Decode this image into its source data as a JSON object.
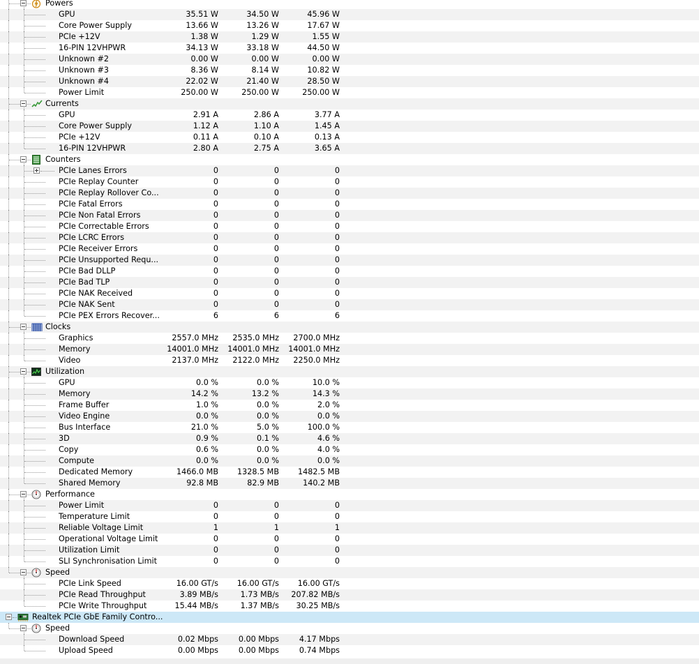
{
  "window": {
    "title": "",
    "selection_color": "#cde8f7"
  },
  "tree": [
    {
      "kind": "group",
      "label": "Powers",
      "icon": "power-icon",
      "level": 1,
      "first": true
    },
    {
      "kind": "sensor",
      "label": "GPU",
      "values": [
        "35.51 W",
        "34.50 W",
        "45.96 W"
      ]
    },
    {
      "kind": "sensor",
      "label": "Core Power Supply",
      "values": [
        "13.66 W",
        "13.26 W",
        "17.67 W"
      ]
    },
    {
      "kind": "sensor",
      "label": "PCIe +12V",
      "values": [
        "1.38 W",
        "1.29 W",
        "1.55 W"
      ]
    },
    {
      "kind": "sensor",
      "label": "16-PIN 12VHPWR",
      "values": [
        "34.13 W",
        "33.18 W",
        "44.50 W"
      ]
    },
    {
      "kind": "sensor",
      "label": "Unknown #2",
      "values": [
        "0.00 W",
        "0.00 W",
        "0.00 W"
      ]
    },
    {
      "kind": "sensor",
      "label": "Unknown #3",
      "values": [
        "8.36 W",
        "8.14 W",
        "10.82 W"
      ]
    },
    {
      "kind": "sensor",
      "label": "Unknown #4",
      "values": [
        "22.02 W",
        "21.40 W",
        "28.50 W"
      ]
    },
    {
      "kind": "sensor",
      "label": "Power Limit",
      "values": [
        "250.00 W",
        "250.00 W",
        "250.00 W"
      ]
    },
    {
      "kind": "group",
      "label": "Currents",
      "icon": "current-icon",
      "level": 1
    },
    {
      "kind": "sensor",
      "label": "GPU",
      "values": [
        "2.91 A",
        "2.86 A",
        "3.77 A"
      ]
    },
    {
      "kind": "sensor",
      "label": "Core Power Supply",
      "values": [
        "1.12 A",
        "1.10 A",
        "1.45 A"
      ]
    },
    {
      "kind": "sensor",
      "label": "PCIe +12V",
      "values": [
        "0.11 A",
        "0.10 A",
        "0.13 A"
      ]
    },
    {
      "kind": "sensor",
      "label": "16-PIN 12VHPWR",
      "values": [
        "2.80 A",
        "2.75 A",
        "3.65 A"
      ]
    },
    {
      "kind": "group",
      "label": "Counters",
      "icon": "counter-icon",
      "level": 1
    },
    {
      "kind": "sensor",
      "label": "PCIe Lanes Errors",
      "values": [
        "0",
        "0",
        "0"
      ],
      "expandable": true
    },
    {
      "kind": "sensor",
      "label": "PCIe Replay Counter",
      "values": [
        "0",
        "0",
        "0"
      ]
    },
    {
      "kind": "sensor",
      "label": "PCIe Replay Rollover Co...",
      "values": [
        "0",
        "0",
        "0"
      ]
    },
    {
      "kind": "sensor",
      "label": "PCIe Fatal Errors",
      "values": [
        "0",
        "0",
        "0"
      ]
    },
    {
      "kind": "sensor",
      "label": "PCIe Non Fatal Errors",
      "values": [
        "0",
        "0",
        "0"
      ]
    },
    {
      "kind": "sensor",
      "label": "PCIe Correctable Errors",
      "values": [
        "0",
        "0",
        "0"
      ]
    },
    {
      "kind": "sensor",
      "label": "PCIe LCRC Errors",
      "values": [
        "0",
        "0",
        "0"
      ]
    },
    {
      "kind": "sensor",
      "label": "PCIe Receiver Errors",
      "values": [
        "0",
        "0",
        "0"
      ]
    },
    {
      "kind": "sensor",
      "label": "PCIe Unsupported Requ...",
      "values": [
        "0",
        "0",
        "0"
      ]
    },
    {
      "kind": "sensor",
      "label": "PCIe Bad DLLP",
      "values": [
        "0",
        "0",
        "0"
      ]
    },
    {
      "kind": "sensor",
      "label": "PCIe Bad TLP",
      "values": [
        "0",
        "0",
        "0"
      ]
    },
    {
      "kind": "sensor",
      "label": "PCIe NAK Received",
      "values": [
        "0",
        "0",
        "0"
      ]
    },
    {
      "kind": "sensor",
      "label": "PCIe NAK Sent",
      "values": [
        "0",
        "0",
        "0"
      ]
    },
    {
      "kind": "sensor",
      "label": "PCIe PEX Errors Recover...",
      "values": [
        "6",
        "6",
        "6"
      ]
    },
    {
      "kind": "group",
      "label": "Clocks",
      "icon": "clock-icon",
      "level": 1
    },
    {
      "kind": "sensor",
      "label": "Graphics",
      "values": [
        "2557.0 MHz",
        "2535.0 MHz",
        "2700.0 MHz"
      ]
    },
    {
      "kind": "sensor",
      "label": "Memory",
      "values": [
        "14001.0 MHz",
        "14001.0 MHz",
        "14001.0 MHz"
      ]
    },
    {
      "kind": "sensor",
      "label": "Video",
      "values": [
        "2137.0 MHz",
        "2122.0 MHz",
        "2250.0 MHz"
      ]
    },
    {
      "kind": "group",
      "label": "Utilization",
      "icon": "utilization-icon",
      "level": 1
    },
    {
      "kind": "sensor",
      "label": "GPU",
      "values": [
        "0.0 %",
        "0.0 %",
        "10.0 %"
      ]
    },
    {
      "kind": "sensor",
      "label": "Memory",
      "values": [
        "14.2 %",
        "13.2 %",
        "14.3 %"
      ]
    },
    {
      "kind": "sensor",
      "label": "Frame Buffer",
      "values": [
        "1.0 %",
        "0.0 %",
        "2.0 %"
      ]
    },
    {
      "kind": "sensor",
      "label": "Video Engine",
      "values": [
        "0.0 %",
        "0.0 %",
        "0.0 %"
      ]
    },
    {
      "kind": "sensor",
      "label": "Bus Interface",
      "values": [
        "21.0 %",
        "5.0 %",
        "100.0 %"
      ]
    },
    {
      "kind": "sensor",
      "label": "3D",
      "values": [
        "0.9 %",
        "0.1 %",
        "4.6 %"
      ]
    },
    {
      "kind": "sensor",
      "label": "Copy",
      "values": [
        "0.6 %",
        "0.0 %",
        "4.0 %"
      ]
    },
    {
      "kind": "sensor",
      "label": "Compute",
      "values": [
        "0.0 %",
        "0.0 %",
        "0.0 %"
      ]
    },
    {
      "kind": "sensor",
      "label": "Dedicated Memory",
      "values": [
        "1466.0 MB",
        "1328.5 MB",
        "1482.5 MB"
      ]
    },
    {
      "kind": "sensor",
      "label": "Shared Memory",
      "values": [
        "92.8 MB",
        "82.9 MB",
        "140.2 MB"
      ]
    },
    {
      "kind": "group",
      "label": "Performance",
      "icon": "gauge-icon",
      "level": 1
    },
    {
      "kind": "sensor",
      "label": "Power Limit",
      "values": [
        "0",
        "0",
        "0"
      ]
    },
    {
      "kind": "sensor",
      "label": "Temperature Limit",
      "values": [
        "0",
        "0",
        "0"
      ]
    },
    {
      "kind": "sensor",
      "label": "Reliable Voltage Limit",
      "values": [
        "1",
        "1",
        "1"
      ]
    },
    {
      "kind": "sensor",
      "label": "Operational Voltage Limit",
      "values": [
        "0",
        "0",
        "0"
      ]
    },
    {
      "kind": "sensor",
      "label": "Utilization Limit",
      "values": [
        "0",
        "0",
        "0"
      ]
    },
    {
      "kind": "sensor",
      "label": "SLI Synchronisation Limit",
      "values": [
        "0",
        "0",
        "0"
      ]
    },
    {
      "kind": "group",
      "label": "Speed",
      "icon": "gauge-icon",
      "level": 1,
      "last_in_device": true
    },
    {
      "kind": "sensor",
      "label": "PCIe Link Speed",
      "values": [
        "16.00 GT/s",
        "16.00 GT/s",
        "16.00 GT/s"
      ]
    },
    {
      "kind": "sensor",
      "label": "PCIe Read Throughput",
      "values": [
        "3.89 MB/s",
        "1.73 MB/s",
        "207.82 MB/s"
      ]
    },
    {
      "kind": "sensor",
      "label": "PCIe Write Throughput",
      "values": [
        "15.44 MB/s",
        "1.37 MB/s",
        "30.25 MB/s"
      ]
    },
    {
      "kind": "device",
      "label": "Realtek PCIe GbE Family Contro...",
      "icon": "network-card-icon",
      "level": 0,
      "selected": true
    },
    {
      "kind": "group",
      "label": "Speed",
      "icon": "gauge-icon",
      "level": 1,
      "last_in_device": true,
      "first": true
    },
    {
      "kind": "sensor",
      "label": "Download Speed",
      "values": [
        "0.02 Mbps",
        "0.00 Mbps",
        "4.17 Mbps"
      ]
    },
    {
      "kind": "sensor",
      "label": "Upload Speed",
      "values": [
        "0.00 Mbps",
        "0.00 Mbps",
        "0.74 Mbps"
      ]
    }
  ]
}
